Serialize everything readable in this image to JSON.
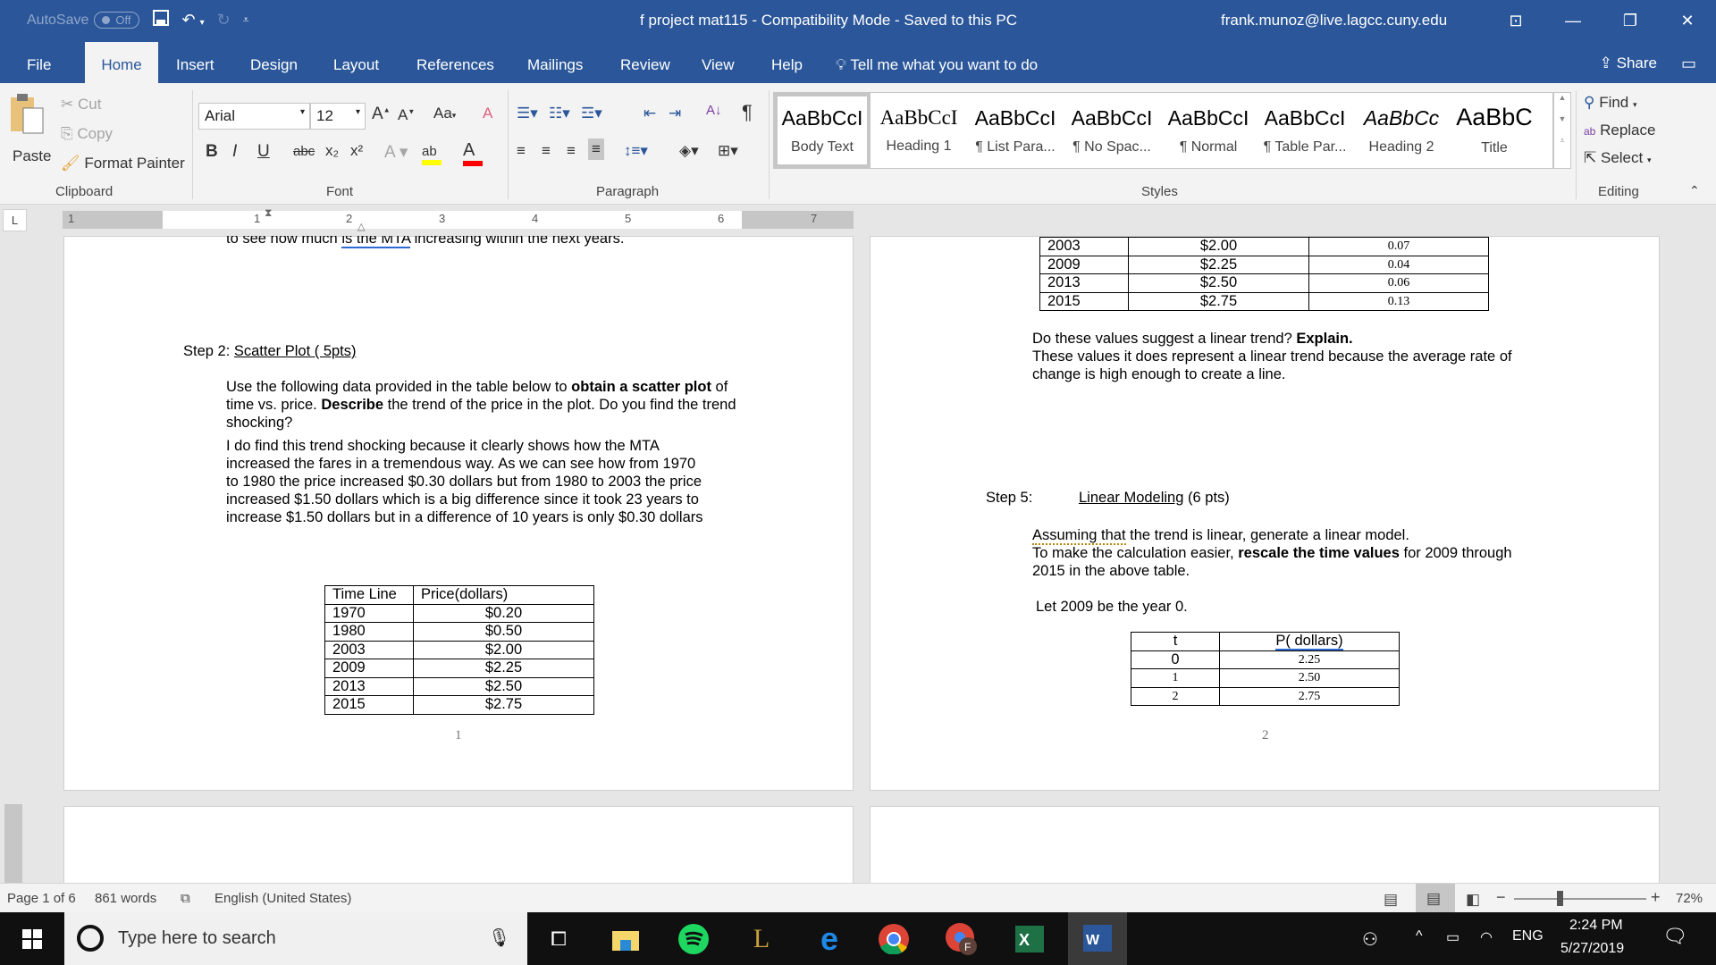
{
  "titlebar": {
    "autosave_label": "AutoSave",
    "autosave_state": "Off",
    "document_title": "f project mat115  -  Compatibility Mode  -  Saved to this PC",
    "user_email": "frank.munoz@live.lagcc.cuny.edu"
  },
  "tabs": [
    "File",
    "Home",
    "Insert",
    "Design",
    "Layout",
    "References",
    "Mailings",
    "Review",
    "View",
    "Help"
  ],
  "active_tab": "Home",
  "tell_me": "Tell me what you want to do",
  "share_label": "Share",
  "ribbon": {
    "clipboard": {
      "paste": "Paste",
      "cut": "Cut",
      "copy": "Copy",
      "format_painter": "Format Painter",
      "label": "Clipboard"
    },
    "font": {
      "name": "Arial",
      "size": "12",
      "label": "Font",
      "bold": "B",
      "italic": "I",
      "underline": "U",
      "strikethrough": "abc",
      "subscript": "x₂",
      "superscript": "x²",
      "change_case": "Aa",
      "highlight_color": "#ffff00",
      "font_color": "#ff0000"
    },
    "paragraph": {
      "label": "Paragraph"
    },
    "styles": {
      "label": "Styles",
      "items": [
        {
          "sample": "AaBbCcI",
          "name": "Body Text",
          "selected": true
        },
        {
          "sample": "AaBbCcI",
          "name": "Heading 1"
        },
        {
          "sample": "AaBbCcI",
          "name": "¶ List Para..."
        },
        {
          "sample": "AaBbCcI",
          "name": "¶ No Spac..."
        },
        {
          "sample": "AaBbCcI",
          "name": "¶ Normal"
        },
        {
          "sample": "AaBbCcI",
          "name": "¶ Table Par..."
        },
        {
          "sample": "AaBbCc",
          "name": "Heading 2"
        },
        {
          "sample": "AaBbC",
          "name": "Title"
        }
      ]
    },
    "editing": {
      "label": "Editing",
      "find": "Find",
      "replace": "Replace",
      "select": "Select"
    }
  },
  "ruler": {
    "numbers": [
      "1",
      "1",
      "2",
      "3",
      "4",
      "5",
      "6",
      "7"
    ]
  },
  "page1": {
    "cut_line_pre": "to see how much ",
    "cut_line_link": "is the MTA",
    "cut_line_post": " increasing within the next years.",
    "step2_prefix": "Step 2: ",
    "step2_title": "Scatter Plot ( 5pts)",
    "instr_1": "Use the following data provided in the table below to ",
    "instr_bold1": "obtain a scatter plot",
    "instr_2": " of time vs. price. ",
    "instr_bold2": "Describe",
    "instr_3": " the trend of the price in the plot. Do you find the trend shocking?",
    "answer_lines": [
      "I do find this trend shocking because it clearly shows how the MTA",
      "increased the fares in a tremendous way. As we can see how from 1970",
      "to 1980 the price increased $0.30 dollars but from 1980 to 2003 the price",
      "increased $1.50 dollars which is a big difference since it took 23 years to",
      "increase $1.50 dollars but in a difference of 10 years is only $0.30 dollars"
    ],
    "table": {
      "headers": [
        "Time Line",
        "Price(dollars)"
      ],
      "rows": [
        [
          "1970",
          "$0.20"
        ],
        [
          "1980",
          "$0.50"
        ],
        [
          "2003",
          "$2.00"
        ],
        [
          "2009",
          "$2.25"
        ],
        [
          "2013",
          "$2.50"
        ],
        [
          "2015",
          "$2.75"
        ]
      ]
    },
    "page_number": "1"
  },
  "page2": {
    "table": {
      "rows": [
        [
          "2003",
          "$2.00",
          "0.07"
        ],
        [
          "2009",
          "$2.25",
          "0.04"
        ],
        [
          "2013",
          "$2.50",
          "0.06"
        ],
        [
          "2015",
          "$2.75",
          "0.13"
        ]
      ]
    },
    "question": "Do these values suggest a linear trend? ",
    "question_bold": "Explain.",
    "answer_lines": [
      "These values it does represent a linear trend because the average rate of",
      "change is high enough to create a line."
    ],
    "step5_prefix": "Step 5:",
    "step5_title": "Linear Modeling",
    "step5_pts": " (6 pts)",
    "assume_u": "Assuming that",
    "assume_rest": " the trend is linear, generate a linear model.",
    "rescale_1": "To make the calculation easier, ",
    "rescale_bold": "rescale the time values",
    "rescale_2": " for 2009 through",
    "rescale_3": "2015 in the above table.",
    "let_line": "Let 2009 be the year 0.",
    "table2": {
      "headers": [
        "t",
        "P( dollars)"
      ],
      "rows": [
        [
          "0",
          "2.25"
        ],
        [
          "1",
          "2.50"
        ],
        [
          "2",
          "2.75"
        ]
      ]
    },
    "page_number": "2"
  },
  "statusbar": {
    "page": "Page 1 of 6",
    "words": "861 words",
    "language": "English (United States)",
    "zoom": "72%",
    "zoom_level": 0.72
  },
  "taskbar": {
    "search_placeholder": "Type here to search",
    "language": "ENG",
    "time": "2:24 PM",
    "date": "5/27/2019"
  }
}
